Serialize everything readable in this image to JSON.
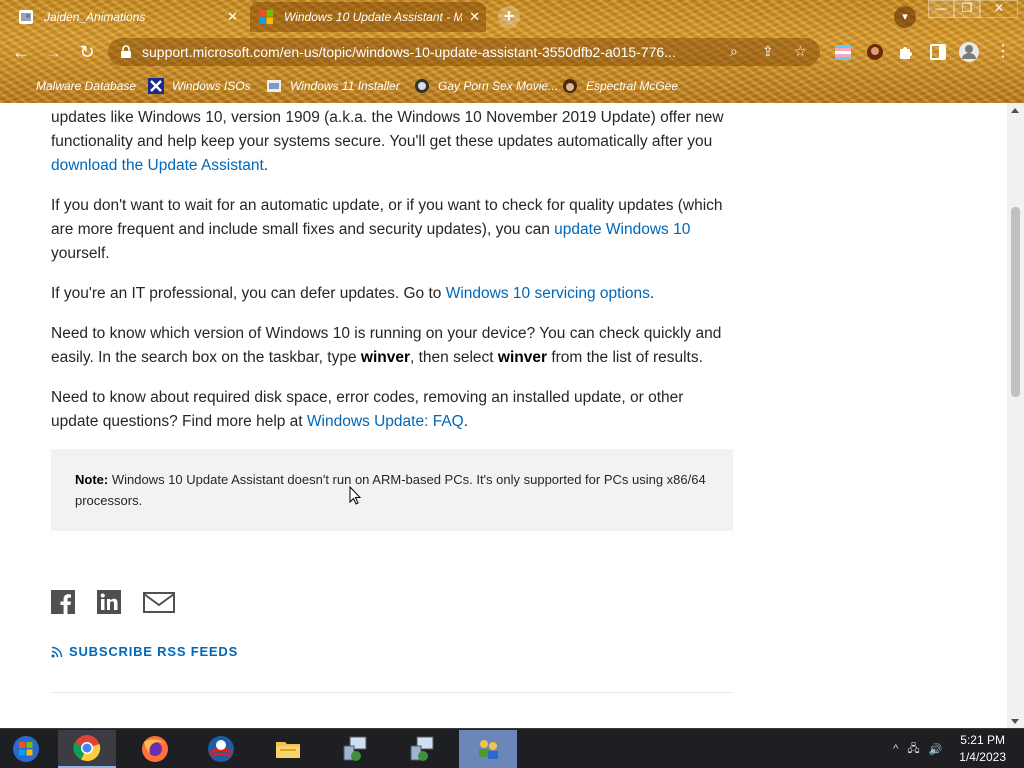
{
  "browser": {
    "tabs": [
      {
        "title": "Jaiden_Animations",
        "close": "✕"
      },
      {
        "title": "Windows 10 Update Assistant - M",
        "close": "✕"
      }
    ],
    "new_tab": "+",
    "window_controls": {
      "minimize": "—",
      "restore": "❐",
      "close": "✕"
    },
    "url": "support.microsoft.com/en-us/topic/windows-10-update-assistant-3550dfb2-a015-776...",
    "bookmarks": [
      {
        "label": "Malware Database"
      },
      {
        "label": "Windows ISOs"
      },
      {
        "label": "Windows 11 Installer"
      },
      {
        "label": "Gay Porn Sex Movie..."
      },
      {
        "label": "Espectral McGee"
      }
    ]
  },
  "article": {
    "p1_a": "updates like Windows 10, version 1909 (a.k.a. the Windows 10 November 2019 Update) offer new functionality and help keep your systems secure. You'll get these updates automatically after you ",
    "p1_link": "download the Update Assistant",
    "p1_b": ".",
    "p2_a": "If you don't want to wait for an automatic update, or if you want to check for quality updates (which are more frequent and include small fixes and security updates), you can ",
    "p2_link": "update Windows 10",
    "p2_b": " yourself.",
    "p3_a": "If you're an IT professional, you can defer updates.  Go to ",
    "p3_link": "Windows 10 servicing options",
    "p3_b": ".",
    "p4_a": "Need to know which version of Windows 10 is running on your device? You can check quickly and easily.  In the search box on the taskbar, type ",
    "p4_bold1": "winver",
    "p4_mid": ", then select ",
    "p4_bold2": "winver",
    "p4_b": " from the list of results.",
    "p5_a": "Need to know about required disk space, error codes, removing an installed update, or other update questions? Find more help at ",
    "p5_link": "Windows Update: FAQ",
    "p5_b": "."
  },
  "note": {
    "label": "Note:",
    "text": " Windows 10 Update Assistant doesn't run on ARM-based PCs. It's only supported for PCs using x86/64 processors."
  },
  "footer": {
    "rss_label": "SUBSCRIBE RSS FEEDS"
  },
  "taskbar": {
    "time": "5:21 PM",
    "date": "1/4/2023",
    "tray_arrow": "^"
  },
  "colors": {
    "link": "#0067b8",
    "chrome_theme": "#c98a1e",
    "taskbar": "#1e1f22"
  }
}
